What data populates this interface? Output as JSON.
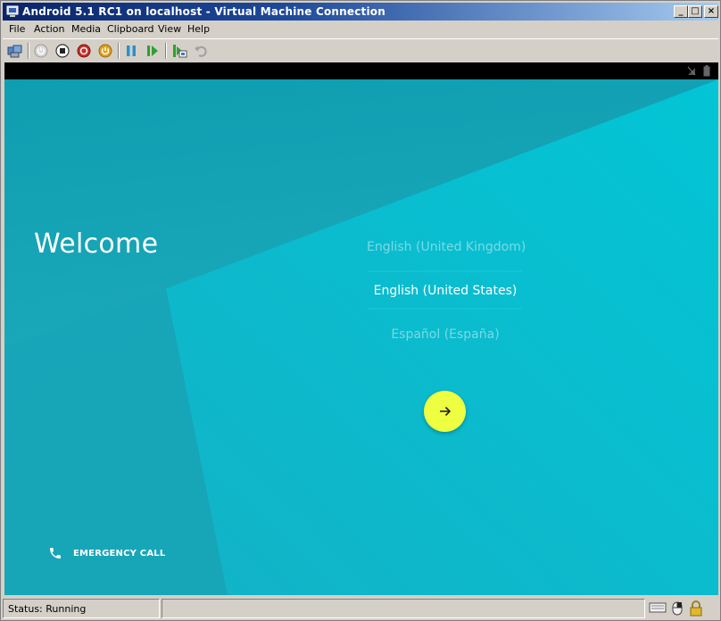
{
  "window": {
    "title": "Android 5.1 RC1 on localhost - Virtual Machine Connection",
    "minimize_glyph": "_",
    "maximize_glyph": "□",
    "close_glyph": "×"
  },
  "menu": {
    "items": [
      "File",
      "Action",
      "Media",
      "Clipboard",
      "View",
      "Help"
    ]
  },
  "toolbar": {
    "icons": [
      "ctrl-alt-del-icon",
      "start-icon",
      "turn-off-icon",
      "shutdown-icon",
      "save-icon",
      "pause-icon",
      "resume-icon",
      "snapshot-icon",
      "revert-icon"
    ]
  },
  "android": {
    "welcome": "Welcome",
    "languages": [
      {
        "label": "English (United Kingdom)",
        "selected": false
      },
      {
        "label": "English (United States)",
        "selected": true
      },
      {
        "label": "Español (España)",
        "selected": false
      }
    ],
    "emergency_call": "EMERGENCY CALL",
    "accent_color": "#eeff41",
    "background_color": "#1aa8b8"
  },
  "status": {
    "text": "Status: Running"
  }
}
